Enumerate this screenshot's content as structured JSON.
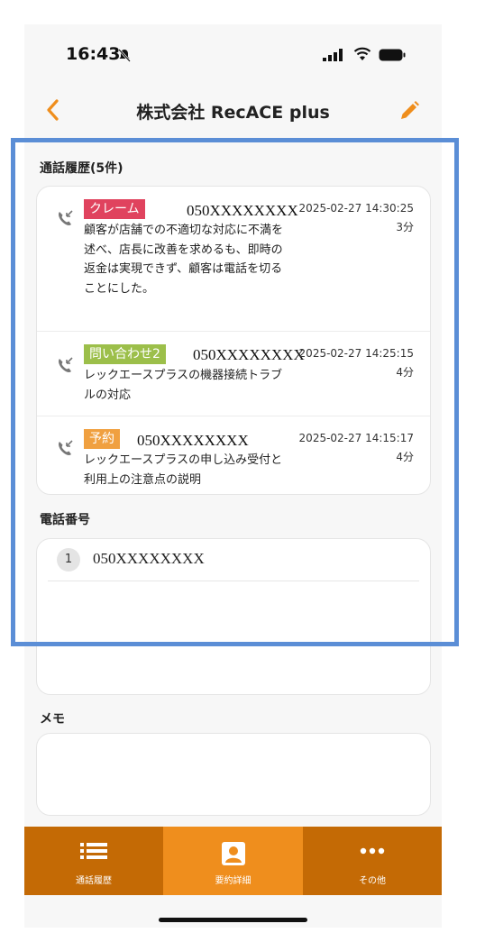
{
  "status_bar": {
    "time": "16:43"
  },
  "header": {
    "title": "株式会社 RecACE plus"
  },
  "call_history": {
    "title": "通話履歴(5件)",
    "items": [
      {
        "tag": "クレーム",
        "tag_color": "#e0435e",
        "number": "050XXXXXXXX",
        "summary": "顧客が店舗での不適切な対応に不満を述べ、店長に改善を求めるも、即時の返金は実現できず、顧客は電話を切ることにした。",
        "datetime": "2025-02-27 14:30:25",
        "duration": "3分"
      },
      {
        "tag": "問い合わせ2",
        "tag_color": "#9cbf4a",
        "number": "050XXXXXXXX",
        "summary": "レックエースプラスの機器接続トラブルの対応",
        "datetime": "2025-02-27 14:25:15",
        "duration": "4分"
      },
      {
        "tag": "予約",
        "tag_color": "#f0a040",
        "number": "050XXXXXXXX",
        "summary": "レックエースプラスの申し込み受付と利用上の注意点の説明",
        "datetime": "2025-02-27 14:15:17",
        "duration": "4分"
      }
    ]
  },
  "phone_numbers": {
    "title": "電話番号",
    "items": [
      {
        "index": "1",
        "number": "050XXXXXXXX"
      }
    ]
  },
  "memo": {
    "title": "メモ"
  },
  "tabbar": {
    "tabs": [
      {
        "label": "通話履歴",
        "icon": "list-icon"
      },
      {
        "label": "要約詳細",
        "icon": "contact-card-icon"
      },
      {
        "label": "その他",
        "icon": "more-icon"
      }
    ]
  },
  "colors": {
    "accent": "#ef8e1d",
    "tabbar": "#c46a05",
    "highlight": "#5b8ed6"
  }
}
